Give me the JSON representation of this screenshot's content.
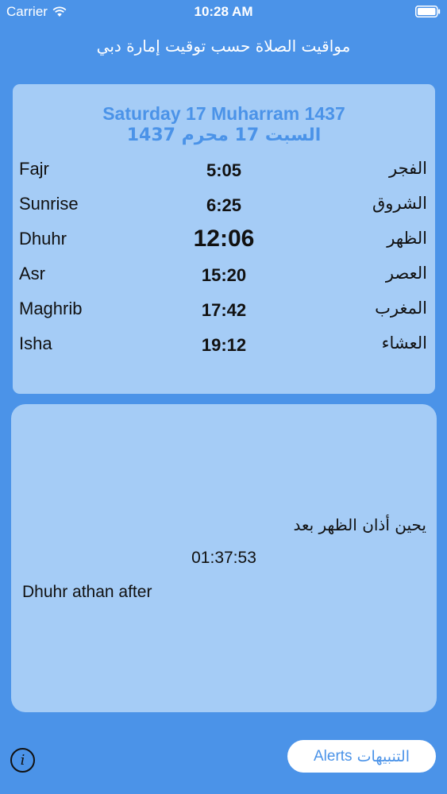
{
  "status_bar": {
    "carrier": "Carrier",
    "time": "10:28 AM"
  },
  "nav": {
    "title": "مواقيت الصلاة حسب توقيت إمارة دبي"
  },
  "date": {
    "gregorian_label": "Saturday 17 Muharram 1437",
    "hijri_arabic": "السبت 17 محرم 1437"
  },
  "prayers": [
    {
      "name_en": "Fajr",
      "time": "5:05",
      "name_ar": "الفجر"
    },
    {
      "name_en": "Sunrise",
      "time": "6:25",
      "name_ar": "الشروق"
    },
    {
      "name_en": "Dhuhr",
      "time": "12:06",
      "name_ar": "الظهر"
    },
    {
      "name_en": "Asr",
      "time": "15:20",
      "name_ar": "العصر"
    },
    {
      "name_en": "Maghrib",
      "time": "17:42",
      "name_ar": "المغرب"
    },
    {
      "name_en": "Isha",
      "time": "19:12",
      "name_ar": "العشاء"
    }
  ],
  "countdown": {
    "label_ar": "يحين أذان الظهر بعد",
    "time": "01:37:53",
    "label_en": "Dhuhr athan after"
  },
  "bottom_bar": {
    "info_icon": "i",
    "alerts_en": "Alerts",
    "alerts_ar": "التنبيهات"
  },
  "colors": {
    "background": "#4b93e8",
    "panel": "#a5ccf6",
    "accent": "#4b93e8"
  }
}
